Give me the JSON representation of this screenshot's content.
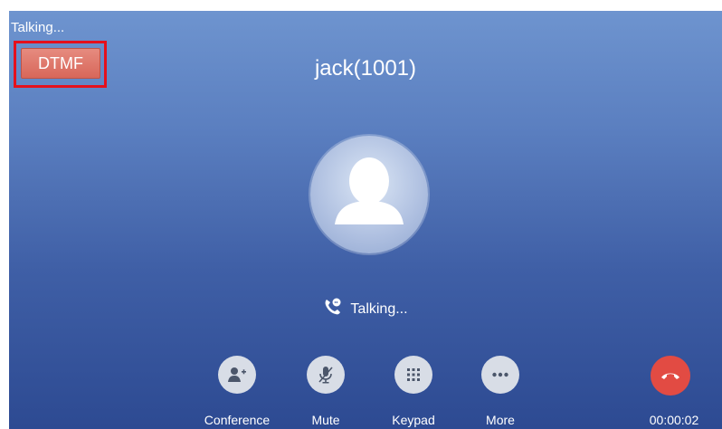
{
  "status": {
    "text": "Talking..."
  },
  "dtmf": {
    "label": "DTMF"
  },
  "call": {
    "caller": "jack(1001)",
    "state_text": "Talking...",
    "duration": "00:00:02"
  },
  "actions": [
    {
      "label": "Conference",
      "icon": "add-person-icon"
    },
    {
      "label": "Mute",
      "icon": "microphone-icon"
    },
    {
      "label": "Keypad",
      "icon": "dialpad-icon"
    },
    {
      "label": "More",
      "icon": "more-icon"
    }
  ],
  "colors": {
    "background_top": "#6e94cf",
    "background_bottom": "#2d4a92",
    "dtmf_button": "#d8675a",
    "highlight_border": "#e5101c",
    "hangup": "#e24b43",
    "action_button": "#d8dde6"
  }
}
